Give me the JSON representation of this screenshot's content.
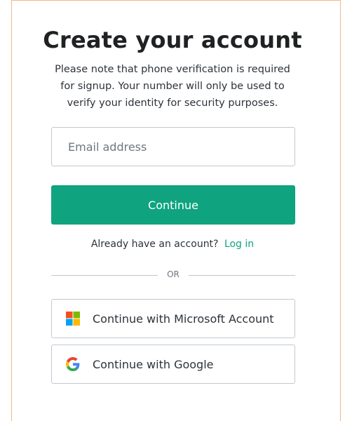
{
  "header": {
    "title": "Create your account",
    "subtitle": "Please note that phone verification is required for signup. Your number will only be used to verify your identity for security purposes."
  },
  "form": {
    "email_placeholder": "Email address",
    "email_value": "",
    "continue_label": "Continue"
  },
  "login": {
    "prompt": "Already have an account?",
    "link_label": "Log in"
  },
  "divider": {
    "label": "OR"
  },
  "social": {
    "microsoft_label": "Continue with Microsoft Account",
    "microsoft_icon": "microsoft-logo-icon",
    "google_label": "Continue with Google",
    "google_icon": "google-logo-icon"
  },
  "colors": {
    "accent": "#10a37f",
    "frame_border": "#f1b98b",
    "field_border": "#c2c8d0",
    "text": "#2d333a"
  }
}
